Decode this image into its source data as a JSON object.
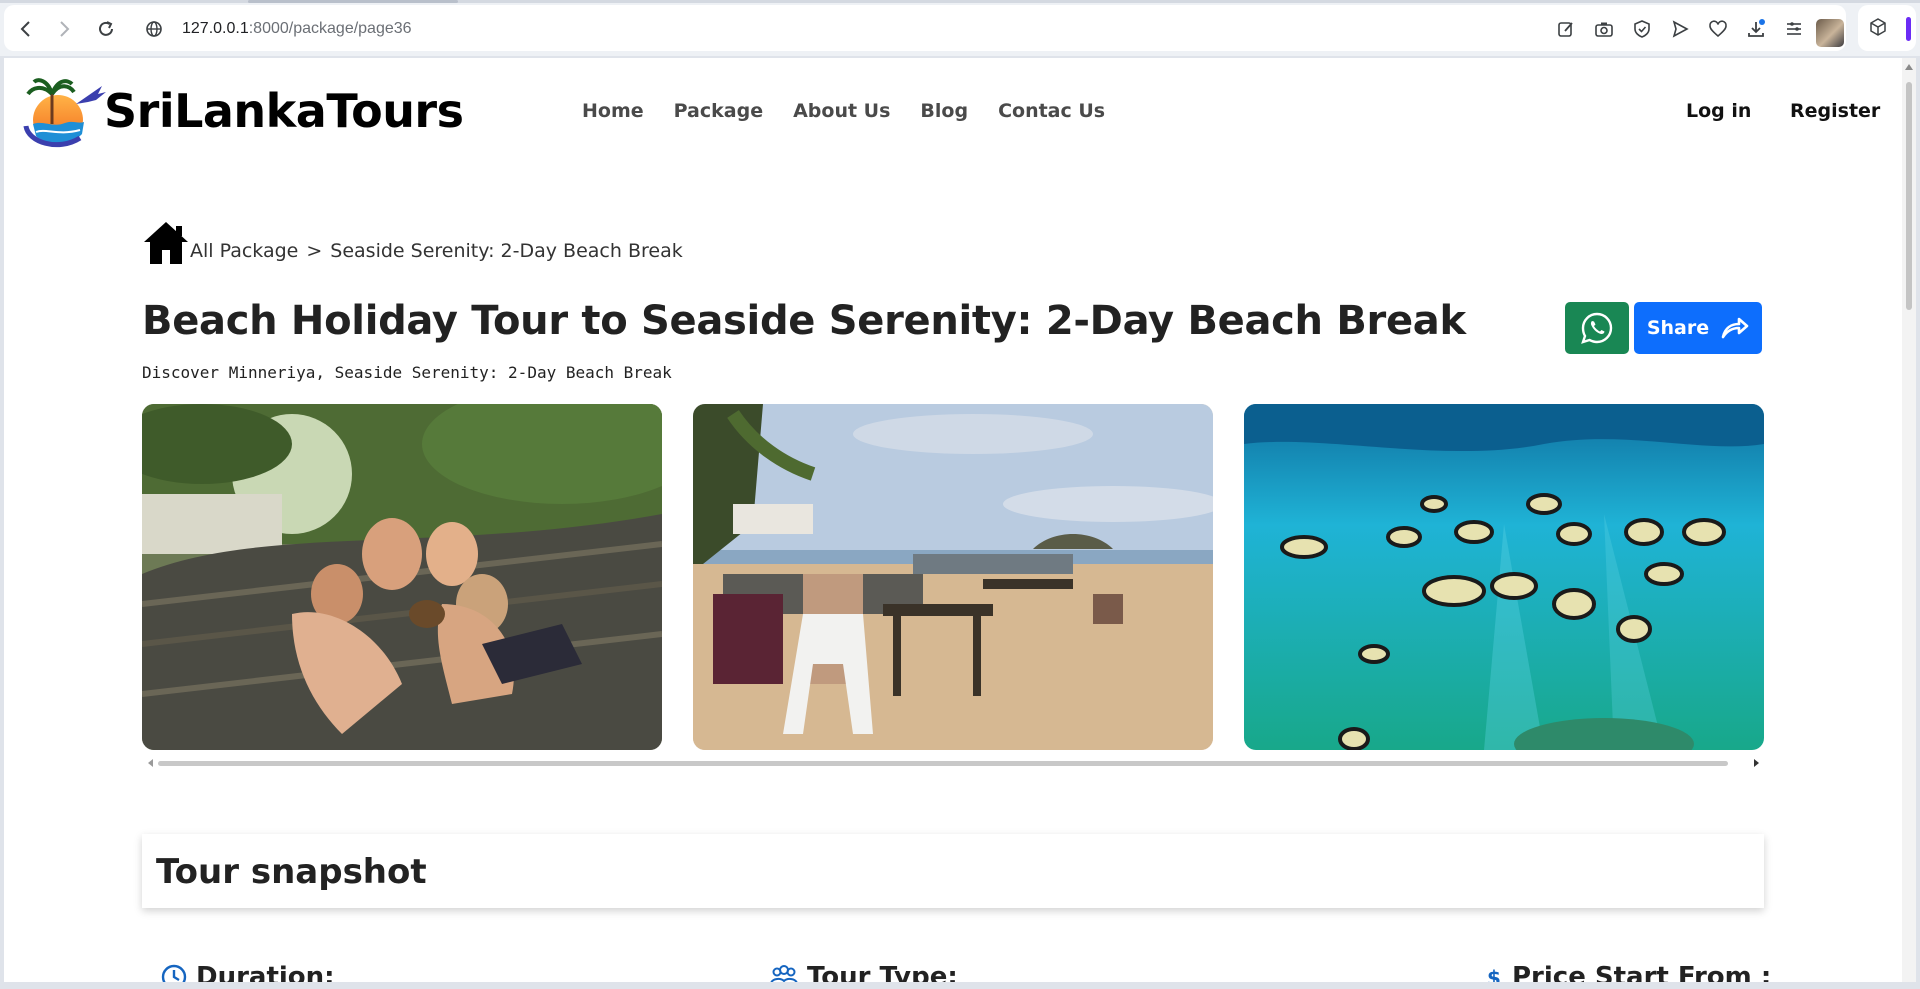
{
  "browser": {
    "url_host": "127.0.0.1",
    "url_path": ":8000/package/page36"
  },
  "header": {
    "brand": "SriLankaTours",
    "nav": [
      "Home",
      "Package",
      "About Us",
      "Blog",
      "Contac Us"
    ],
    "login": "Log in",
    "register": "Register"
  },
  "breadcrumb": {
    "all": "All Package",
    "separator": ">",
    "current": "Seaside Serenity: 2-Day Beach Break"
  },
  "package": {
    "title": "Beach Holiday Tour to Seaside Serenity: 2-Day Beach Break",
    "subtitle": "Discover Minneriya, Seaside Serenity: 2-Day Beach Break",
    "share_label": "Share"
  },
  "gallery": [
    {
      "name": "family-in-hammock-photo"
    },
    {
      "name": "beach-restaurant-photo"
    },
    {
      "name": "underwater-fish-photo"
    }
  ],
  "snapshot": {
    "heading": "Tour snapshot",
    "duration_label": "Duration:",
    "tour_type_label": "Tour Type:",
    "price_label": "Price Start From :"
  },
  "colors": {
    "whatsapp_green": "#198754",
    "share_blue": "#0d6efd",
    "accent_purple": "#6b2cf5"
  }
}
